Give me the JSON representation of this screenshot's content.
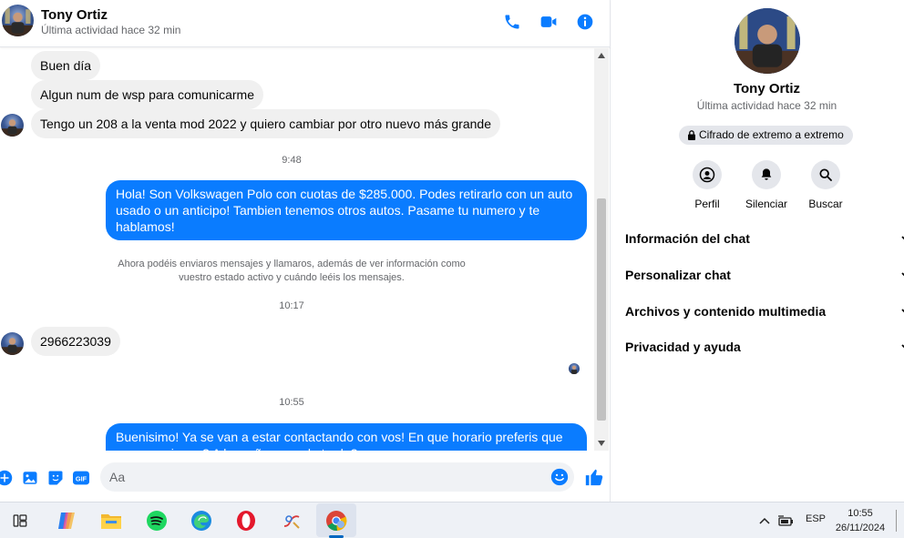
{
  "header": {
    "name": "Tony Ortiz",
    "status": "Última actividad hace 32 min"
  },
  "messages": [
    {
      "type": "in",
      "text": "Buen día"
    },
    {
      "type": "in",
      "text": "Algun num de wsp para comunicarme"
    },
    {
      "type": "in",
      "text": "Tengo un 208 a la venta mod 2022 y quiero cambiar por otro nuevo más grande"
    },
    {
      "type": "time",
      "text": "9:48"
    },
    {
      "type": "out",
      "text": "Hola! Son Volkswagen Polo con cuotas de $285.000. Podes retirarlo con un auto usado o un anticipo! Tambien tenemos otros autos. Pasame tu numero y te hablamos!"
    },
    {
      "type": "system",
      "text": "Ahora podéis enviaros mensajes y llamaros, además de ver información como vuestro estado activo y cuándo leéis los mensajes."
    },
    {
      "type": "time",
      "text": "10:17"
    },
    {
      "type": "in",
      "text": "2966223039"
    },
    {
      "type": "time",
      "text": "10:55"
    },
    {
      "type": "out",
      "text": "Buenisimo! Ya se van a estar contactando con vos! En que horario preferis que se comuniquen? A la mañana o a la tarde?"
    }
  ],
  "composer": {
    "placeholder": "Aa"
  },
  "panel": {
    "name": "Tony Ortiz",
    "status": "Última actividad hace 32 min",
    "e2e": "Cifrado de extremo a extremo",
    "actions": {
      "profile": "Perfil",
      "mute": "Silenciar",
      "search": "Buscar"
    },
    "sections": [
      "Información del chat",
      "Personalizar chat",
      "Archivos y contenido multimedia",
      "Privacidad y ayuda"
    ]
  },
  "taskbar": {
    "language": "ESP",
    "time": "10:55",
    "date": "26/11/2024",
    "apps": [
      "task-view-icon",
      "copilot-icon",
      "file-explorer-icon",
      "spotify-icon",
      "edge-icon",
      "opera-icon",
      "paint-icon",
      "chrome-icon"
    ]
  },
  "colors": {
    "accent": "#0a7cff",
    "incoming": "#f0f0f0",
    "muted": "#65676b"
  }
}
